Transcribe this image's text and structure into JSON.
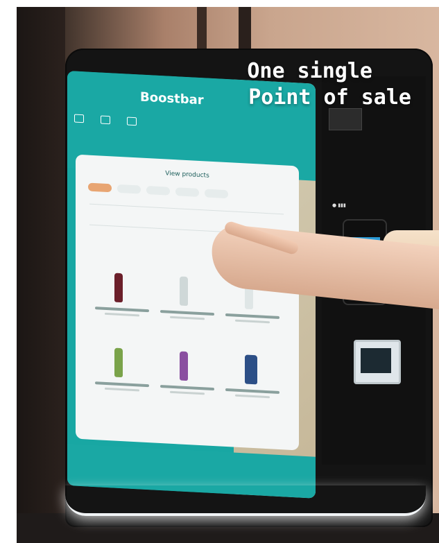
{
  "caption": {
    "line1": "One single",
    "line2": "Point of sale"
  },
  "kiosk_screen": {
    "brand": "Boostbar",
    "panel_title": "View products"
  },
  "colors": {
    "teal": "#18a7a3",
    "accent_orange": "#e8a572",
    "beige": "#e9d2b7"
  },
  "icons": [
    "hand-pointing",
    "card-terminal-icon",
    "barcode-scanner-icon"
  ]
}
